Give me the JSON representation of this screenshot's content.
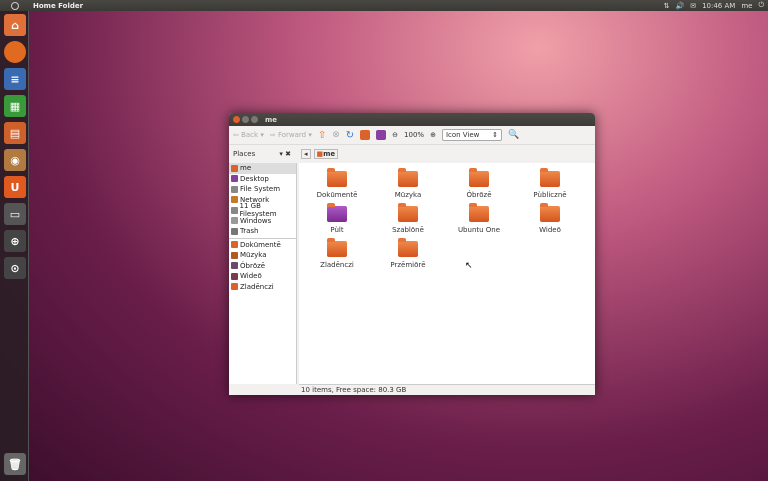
{
  "panel": {
    "title": "Home Folder",
    "time": "10:46 AM",
    "user": "me"
  },
  "launcher": {
    "items": [
      "home-folder",
      "firefox",
      "writer",
      "calc",
      "impress",
      "software-center",
      "ubuntu-one",
      "terminal",
      "workspaces",
      "dash",
      "trash"
    ]
  },
  "window": {
    "title": "me",
    "toolbar": {
      "back": "Back",
      "forward": "Forward",
      "zoom": "100%",
      "view": "Icon View"
    },
    "location": {
      "places": "Places",
      "crumb": "me"
    },
    "sidebar": [
      {
        "label": "me",
        "icon": "home-icon",
        "color": "#d9632a"
      },
      {
        "label": "Desktop",
        "icon": "desktop-icon",
        "color": "#8a3fa0"
      },
      {
        "label": "File System",
        "icon": "drive-icon",
        "color": "#888"
      },
      {
        "label": "Network",
        "icon": "network-icon",
        "color": "#c47a2a"
      },
      {
        "label": "11 GB Filesystem",
        "icon": "drive-icon",
        "color": "#888"
      },
      {
        "label": "Windows",
        "icon": "drive-icon",
        "color": "#999"
      },
      {
        "label": "Trash",
        "icon": "trash-icon",
        "color": "#777"
      },
      {
        "label": "Dokūmentē",
        "icon": "documents-icon",
        "color": "#d9632a"
      },
      {
        "label": "Mūzyka",
        "icon": "music-icon",
        "color": "#b05a20"
      },
      {
        "label": "Óbrōzē",
        "icon": "pictures-icon",
        "color": "#6a4a6a"
      },
      {
        "label": "Wideō",
        "icon": "videos-icon",
        "color": "#7a3a4a"
      },
      {
        "label": "Zladēnczi",
        "icon": "downloads-icon",
        "color": "#d9632a"
      }
    ],
    "items": [
      "Dokūmentē",
      "Mūzyka",
      "Óbrōzē",
      "Pùblicznē",
      "Pùlt",
      "Szablōnē",
      "Ubuntu One",
      "Wideō",
      "Zladēnczi",
      "Przēmiōrē"
    ],
    "status": "10 items, Free space: 80.3 GB"
  }
}
